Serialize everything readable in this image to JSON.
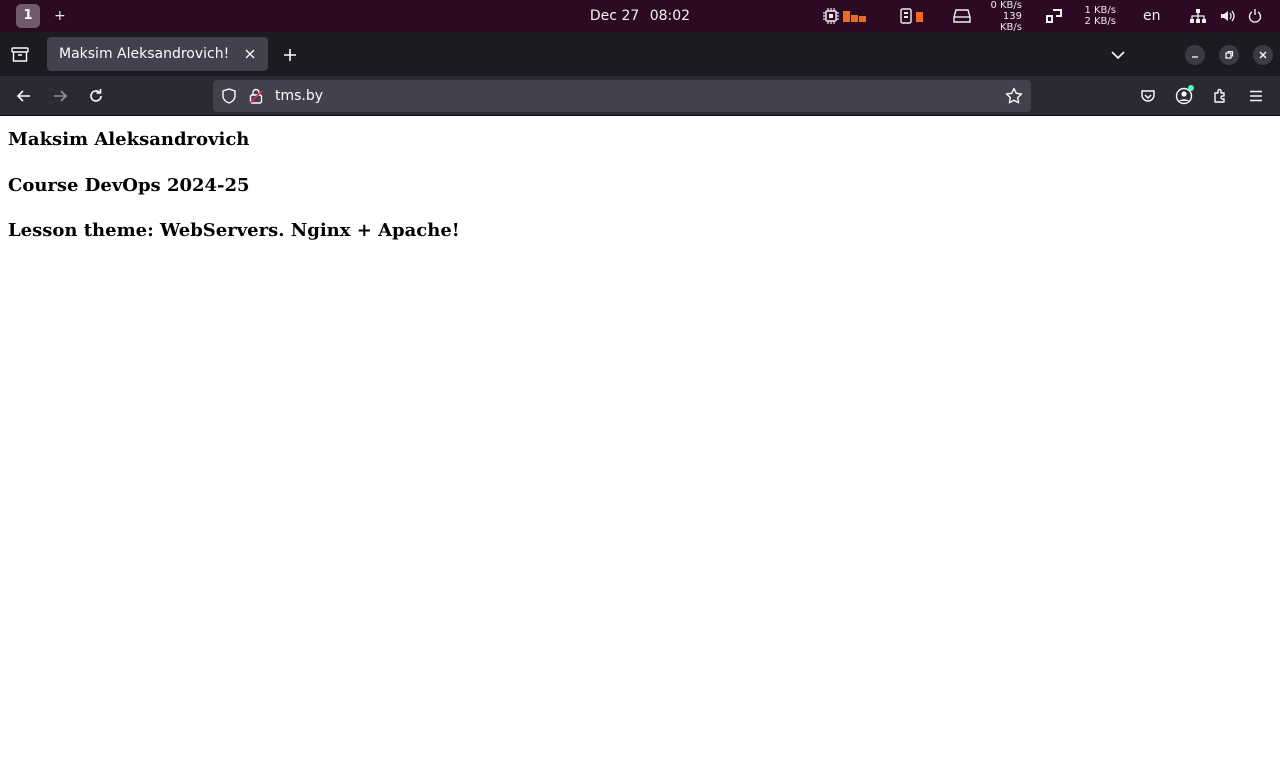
{
  "topbar": {
    "workspace": "1",
    "add_workspace": "+",
    "clock_date": "Dec 27",
    "clock_time": "08:02",
    "net_up_down": [
      "0 KB/s",
      "139 KB/s"
    ],
    "net_up_down_2": [
      "1 KB/s",
      "2 KB/s"
    ],
    "language": "en",
    "accent_color": "#ef6c1a",
    "icons": [
      "cpu-icon",
      "memory-icon",
      "drive-icon",
      "swap-icon",
      "network-icon",
      "volume-icon",
      "power-icon"
    ]
  },
  "browser": {
    "tab": {
      "title": "Maksim Aleksandrovich!"
    },
    "url": "tms.by",
    "icons": [
      "tab-overview-icon",
      "new-tab-icon",
      "tab-list-chevron-icon",
      "minimize-icon",
      "restore-icon",
      "close-icon",
      "back-icon",
      "forward-icon",
      "reload-icon",
      "shield-icon",
      "lock-insecure-icon",
      "bookmark-star-icon",
      "pocket-icon",
      "account-icon",
      "extensions-icon",
      "menu-icon"
    ]
  },
  "page": {
    "heading_1": "Maksim Aleksandrovich",
    "heading_2": "Course DevOps 2024-25",
    "heading_3": "Lesson theme: WebServers. Nginx + Apache!"
  }
}
